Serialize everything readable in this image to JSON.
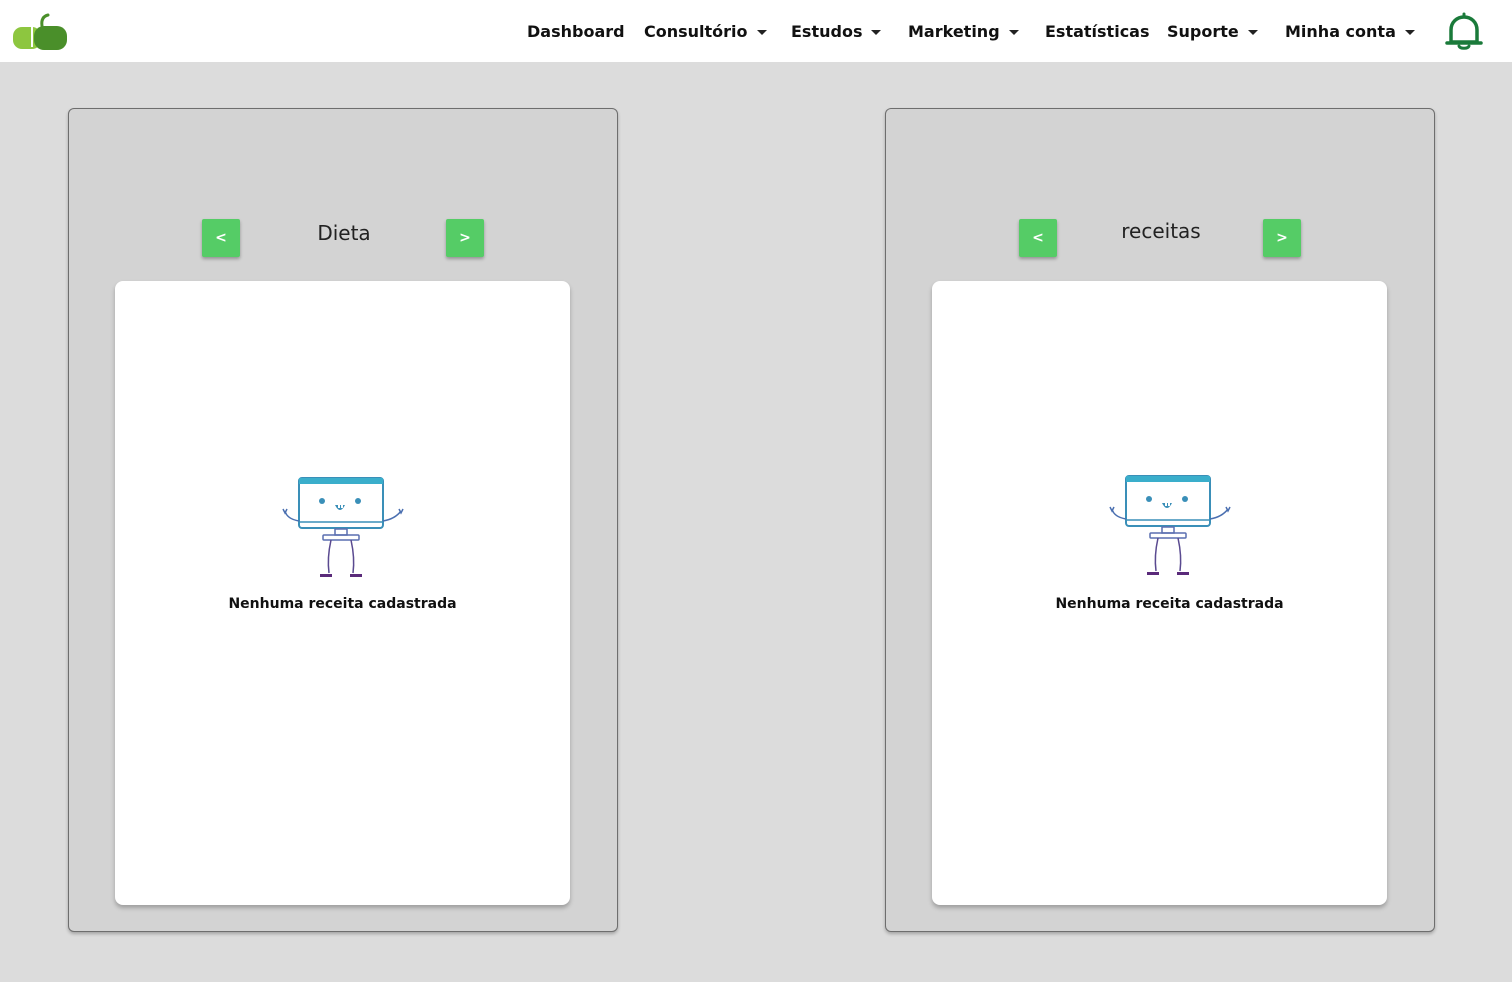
{
  "nav": {
    "items": [
      {
        "label": "Dashboard",
        "has_dropdown": false
      },
      {
        "label": "Consultório",
        "has_dropdown": true
      },
      {
        "label": "Estudos",
        "has_dropdown": true
      },
      {
        "label": "Marketing",
        "has_dropdown": true
      },
      {
        "label": "Estatísticas",
        "has_dropdown": false
      },
      {
        "label": "Suporte",
        "has_dropdown": true
      },
      {
        "label": "Minha conta",
        "has_dropdown": true
      }
    ],
    "bell_icon": "bell-icon"
  },
  "colors": {
    "accent_green": "#55cc66",
    "logo_light_green": "#8dc63f",
    "logo_dark_green": "#4a8f2a",
    "bell_green": "#1a7a3a",
    "mascot_teal": "#3aaecb",
    "mascot_purple": "#5a2a7a"
  },
  "panels": [
    {
      "title": "Dieta",
      "prev_label": "<",
      "next_label": ">",
      "empty_message": "Nenhuma receita cadastrada"
    },
    {
      "title": "receitas",
      "prev_label": "<",
      "next_label": ">",
      "empty_message": "Nenhuma receita cadastrada"
    }
  ]
}
